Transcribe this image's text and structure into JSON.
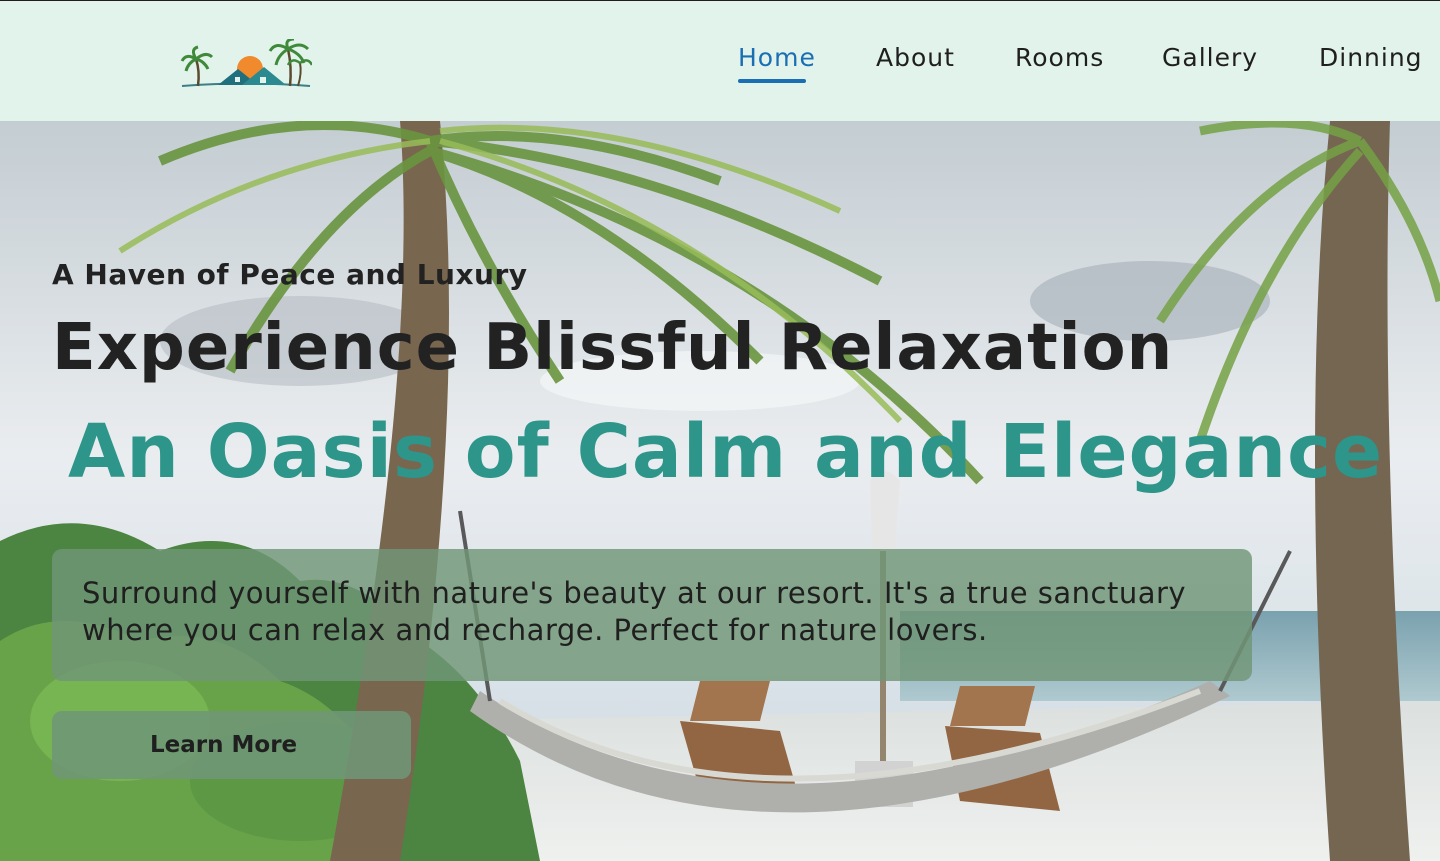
{
  "header": {
    "logo_icon": "resort-palm-house-sunset-icon",
    "nav": [
      {
        "label": "Home",
        "active": true
      },
      {
        "label": "About",
        "active": false
      },
      {
        "label": "Rooms",
        "active": false
      },
      {
        "label": "Gallery",
        "active": false
      },
      {
        "label": "Dinning",
        "active": false
      }
    ]
  },
  "hero": {
    "tagline": "A Haven of Peace and Luxury",
    "headline": "Experience Blissful Relaxation",
    "subheadline": "An Oasis of Calm and Elegance",
    "description": "Surround yourself with nature's beauty at our resort. It's a true sanctuary where you can relax and recharge. Perfect for nature lovers.",
    "cta_label": "Learn More",
    "background_icon": "beach-hammock-palm-photo"
  },
  "colors": {
    "header_bg": "#e1f3ea",
    "nav_active": "#1a6fb4",
    "accent_teal": "#2d958a",
    "panel_green": "#709676"
  }
}
